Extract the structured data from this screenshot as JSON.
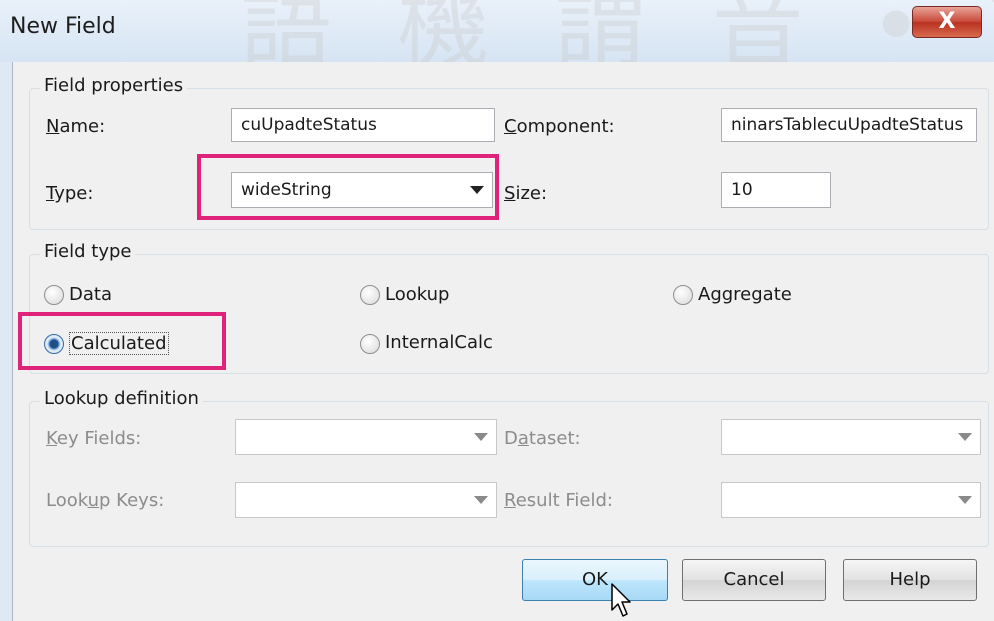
{
  "watermark": "語 機 謂 音 • 譯 物 翻 的",
  "window": {
    "title": "New Field",
    "close_label": "X"
  },
  "field_properties": {
    "group_title": "Field properties",
    "name_label": "Name:",
    "name_value": "cuUpadteStatus",
    "component_label": "Component:",
    "component_value": "ninarsTablecuUpadteStatus",
    "type_label": "Type:",
    "type_value": "wideString",
    "size_label": "Size:",
    "size_value": "10"
  },
  "field_type": {
    "group_title": "Field type",
    "options": [
      "Data",
      "Lookup",
      "Aggregate",
      "Calculated",
      "InternalCalc"
    ],
    "selected": "Calculated"
  },
  "lookup_definition": {
    "group_title": "Lookup definition",
    "key_fields_label": "Key Fields:",
    "dataset_label": "Dataset:",
    "lookup_keys_label": "Lookup Keys:",
    "result_field_label": "Result Field:"
  },
  "buttons": {
    "ok": "OK",
    "cancel": "Cancel",
    "help": "Help"
  },
  "colors": {
    "highlight": "#e0237a",
    "close_button": "#c94a3b"
  }
}
